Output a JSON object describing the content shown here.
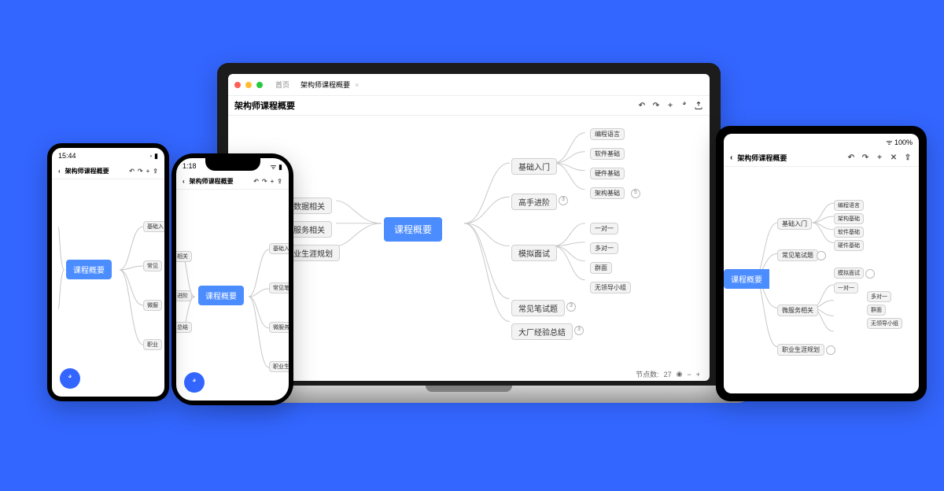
{
  "app_title": "架构师课程概要",
  "root": "课程概要",
  "level1_left": [
    "大数据相关",
    "微服务相关",
    "职业生涯规划"
  ],
  "level1_right": [
    "基础入门",
    "高手进阶",
    "模拟面试",
    "常见笔试题",
    "大厂经验总结"
  ],
  "children_jcru": [
    "编程语言",
    "软件基础",
    "硬件基础",
    "架构基础"
  ],
  "children_mnms": [
    "一对一",
    "多对一",
    "群面",
    "无领导小组"
  ],
  "laptop": {
    "tabs": [
      "首页",
      "架构师课程概要"
    ],
    "node_count_label": "节点数:",
    "node_count_value": "27"
  },
  "phone_time_android": "15:44",
  "phone_time_iphone": "1:18",
  "phone_frag_left": [
    "相关",
    "进阶",
    "总结"
  ],
  "phone_frag_right": [
    "基础入",
    "常见笔",
    "微服务",
    "职业生"
  ],
  "android_right": [
    "基础入",
    "常见",
    "微服",
    "职业"
  ]
}
